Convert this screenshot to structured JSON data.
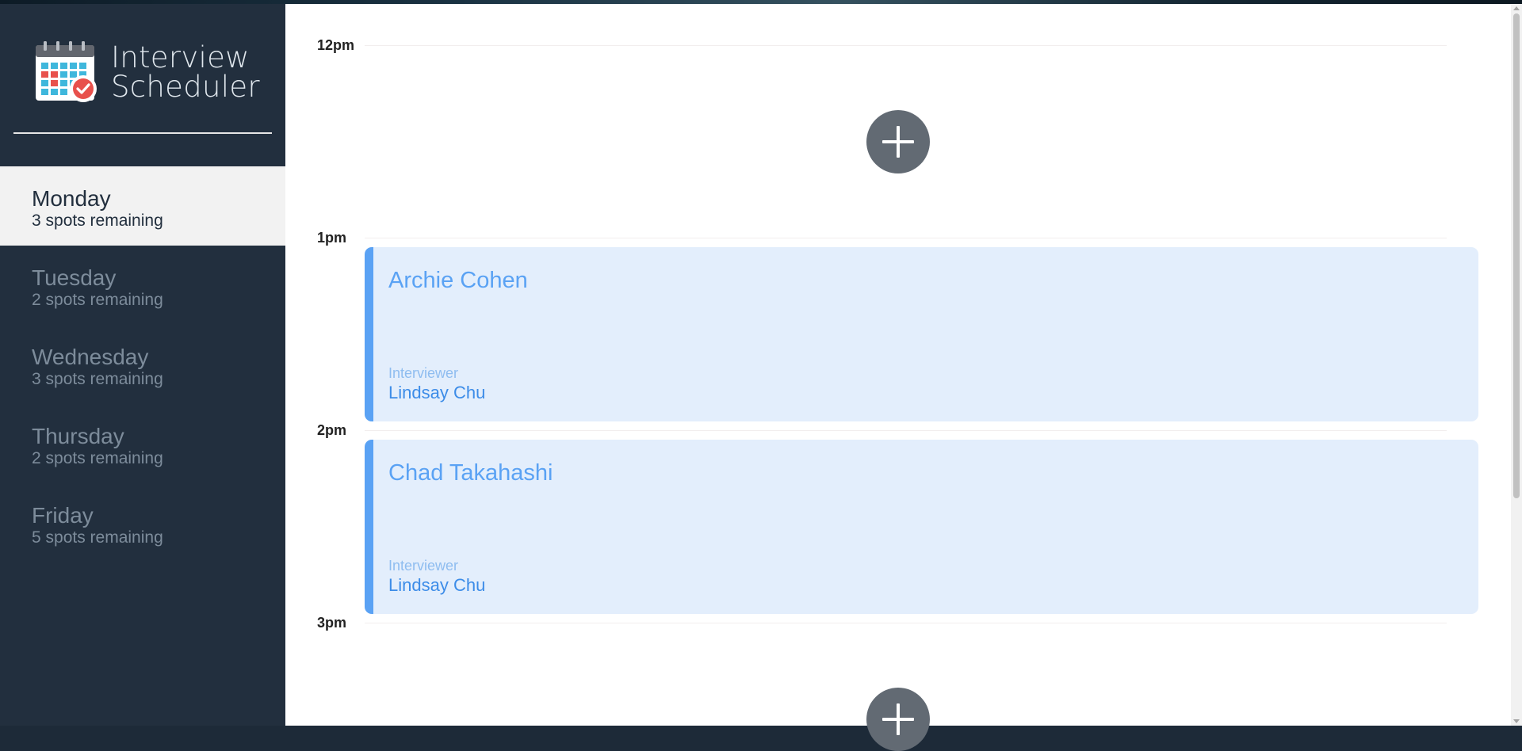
{
  "brand": {
    "line1": "Interview",
    "line2": "Scheduler",
    "icon": "calendar-check-icon"
  },
  "days": [
    {
      "name": "Monday",
      "spots": "3 spots remaining",
      "selected": true
    },
    {
      "name": "Tuesday",
      "spots": "2 spots remaining",
      "selected": false
    },
    {
      "name": "Wednesday",
      "spots": "3 spots remaining",
      "selected": false
    },
    {
      "name": "Thursday",
      "spots": "2 spots remaining",
      "selected": false
    },
    {
      "name": "Friday",
      "spots": "5 spots remaining",
      "selected": false
    }
  ],
  "schedule": {
    "times": [
      "12pm",
      "1pm",
      "2pm",
      "3pm"
    ],
    "appointments": [
      {
        "student": "Archie Cohen",
        "interviewer_label": "Interviewer",
        "interviewer": "Lindsay Chu"
      },
      {
        "student": "Chad Takahashi",
        "interviewer_label": "Interviewer",
        "interviewer": "Lindsay Chu"
      }
    ],
    "add_icon": "plus-icon"
  },
  "colors": {
    "sidebar": "#222f3e",
    "selected_day": "#f2f2f2",
    "card_bg": "#e3eefc",
    "accent": "#5aa2f4",
    "add_button": "#626a73"
  }
}
